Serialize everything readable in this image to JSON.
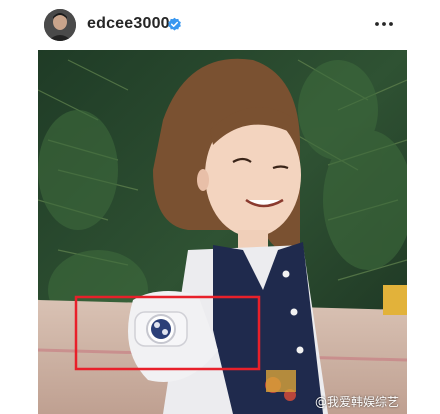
{
  "post": {
    "username": "edcee3000",
    "verified": true,
    "more_icon": "more-horizontal-icon"
  },
  "photo": {
    "description_free": true,
    "highlight_color": "#e8202a"
  },
  "watermark": {
    "text": "@我爱韩娱综艺"
  }
}
